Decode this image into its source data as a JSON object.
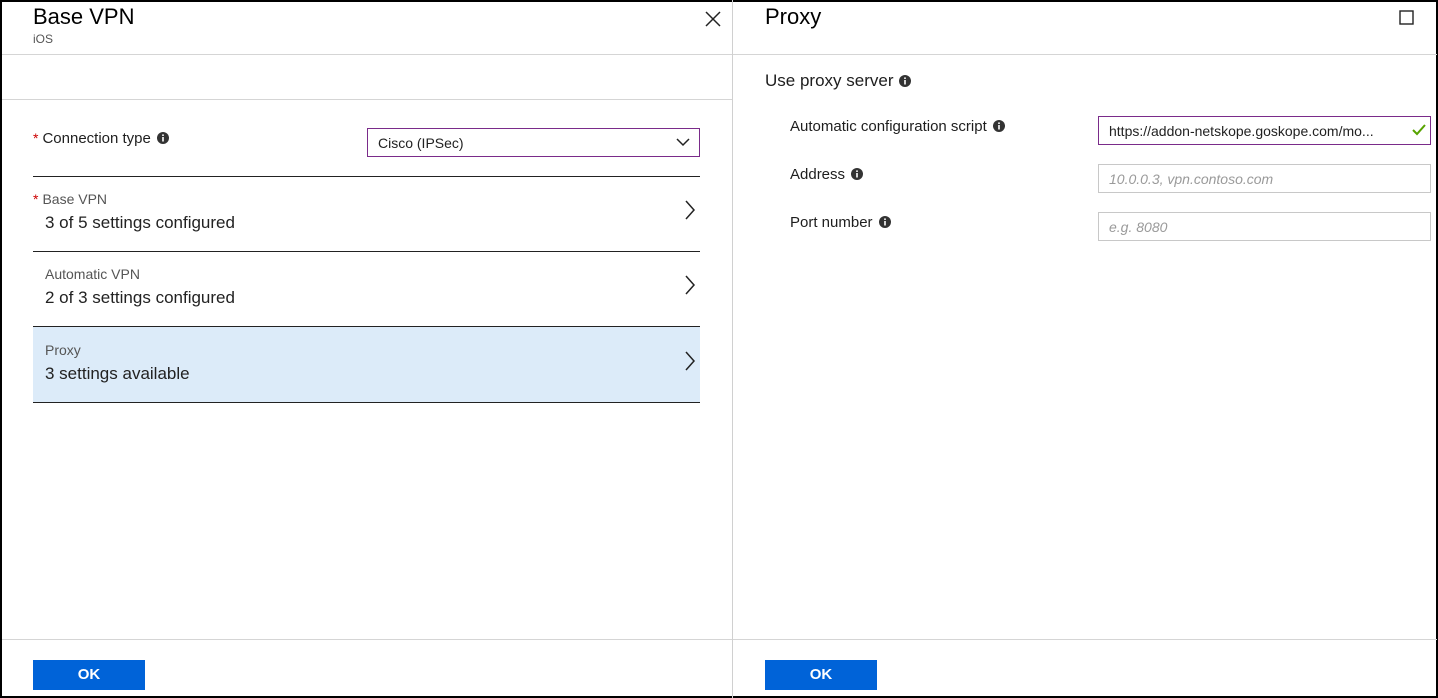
{
  "left_blade": {
    "title": "Base VPN",
    "subtitle": "iOS",
    "connection_type": {
      "label": "Connection type",
      "value": "Cisco (IPSec)",
      "required": "*"
    },
    "nav_items": [
      {
        "small": "Base VPN",
        "big": "3 of 5 settings configured",
        "required": "*"
      },
      {
        "small": "Automatic VPN",
        "big": "2 of 3 settings configured"
      },
      {
        "small": "Proxy",
        "big": "3 settings available"
      }
    ],
    "ok_label": "OK"
  },
  "right_blade": {
    "title": "Proxy",
    "section_label": "Use proxy server",
    "fields": [
      {
        "label": "Automatic configuration script",
        "value": "https://addon-netskope.goskope.com/mo...",
        "placeholder": ""
      },
      {
        "label": "Address",
        "value": "",
        "placeholder": "10.0.0.3, vpn.contoso.com"
      },
      {
        "label": "Port number",
        "value": "",
        "placeholder": "e.g. 8080"
      }
    ],
    "ok_label": "OK"
  },
  "colors": {
    "accent": "#0063d8",
    "active_row": "#dcebf9",
    "focus_border": "#7a2b8a",
    "required": "#cc0000",
    "valid": "#57a300"
  },
  "icons": {
    "close": "close-icon",
    "maximize": "maximize-icon",
    "info": "info-icon",
    "chevron_right": "chevron-right-icon",
    "chevron_down": "chevron-down-icon",
    "check": "check-icon"
  }
}
